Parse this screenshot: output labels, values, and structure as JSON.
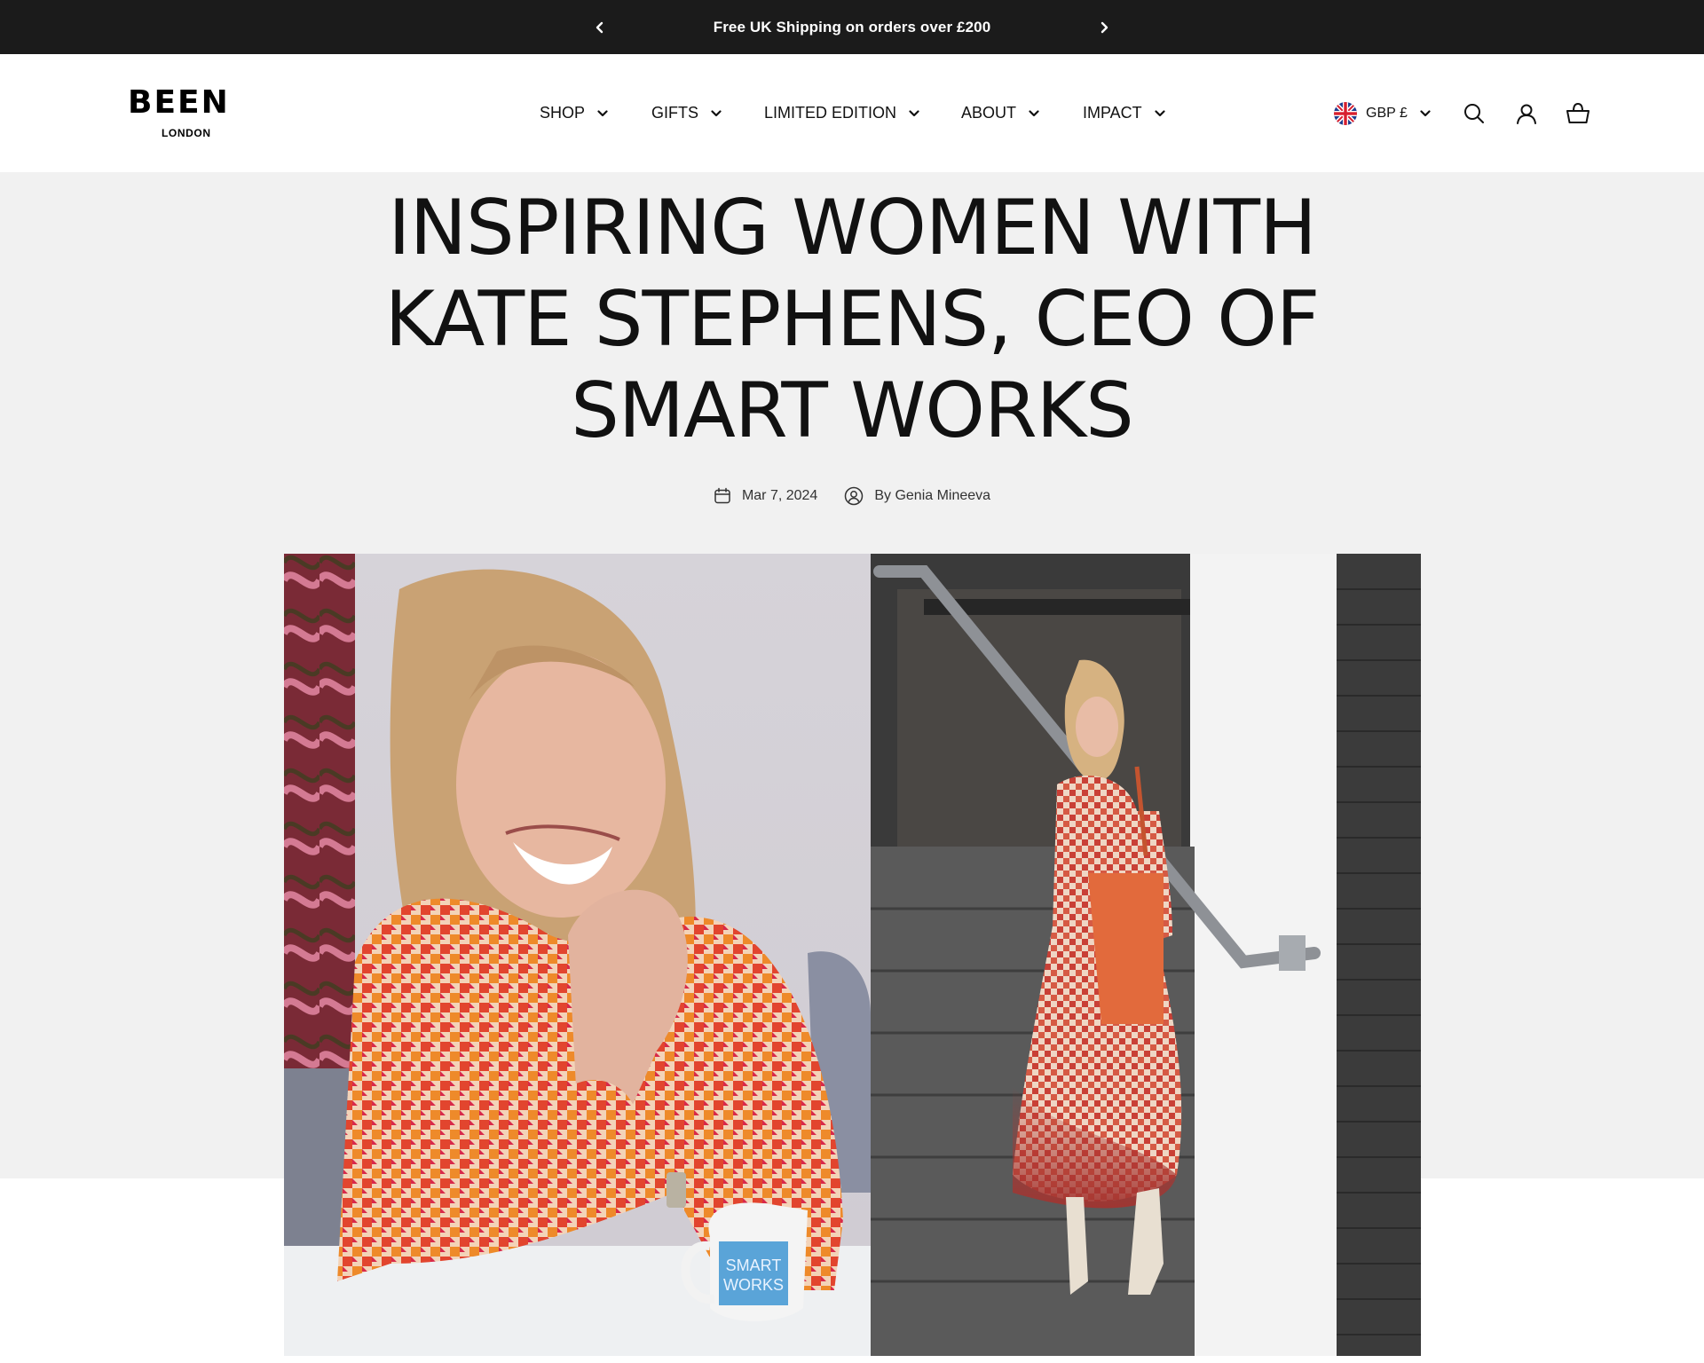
{
  "announcement": {
    "text": "Free UK Shipping on orders over £200",
    "prev_icon": "chevron-left-icon",
    "next_icon": "chevron-right-icon"
  },
  "brand": {
    "name": "BEEN",
    "location": "LONDON"
  },
  "nav": {
    "items": [
      {
        "label": "SHOP"
      },
      {
        "label": "GIFTS"
      },
      {
        "label": "LIMITED EDITION"
      },
      {
        "label": "ABOUT"
      },
      {
        "label": "IMPACT"
      }
    ]
  },
  "tools": {
    "currency": "GBP £",
    "currency_flag": "uk-flag-icon",
    "search_icon": "search-icon",
    "account_icon": "account-icon",
    "cart_icon": "basket-icon"
  },
  "article": {
    "title": "INSPIRING WOMEN WITH KATE STEPHENS, CEO OF SMART WORKS",
    "date": "Mar 7, 2024",
    "author": "By Genia Mineeva",
    "mug_text": "SMART WORKS"
  },
  "colors": {
    "announcement_bg": "#1b1b1b",
    "hero_bg": "#f1f1f1",
    "text": "#111111"
  }
}
